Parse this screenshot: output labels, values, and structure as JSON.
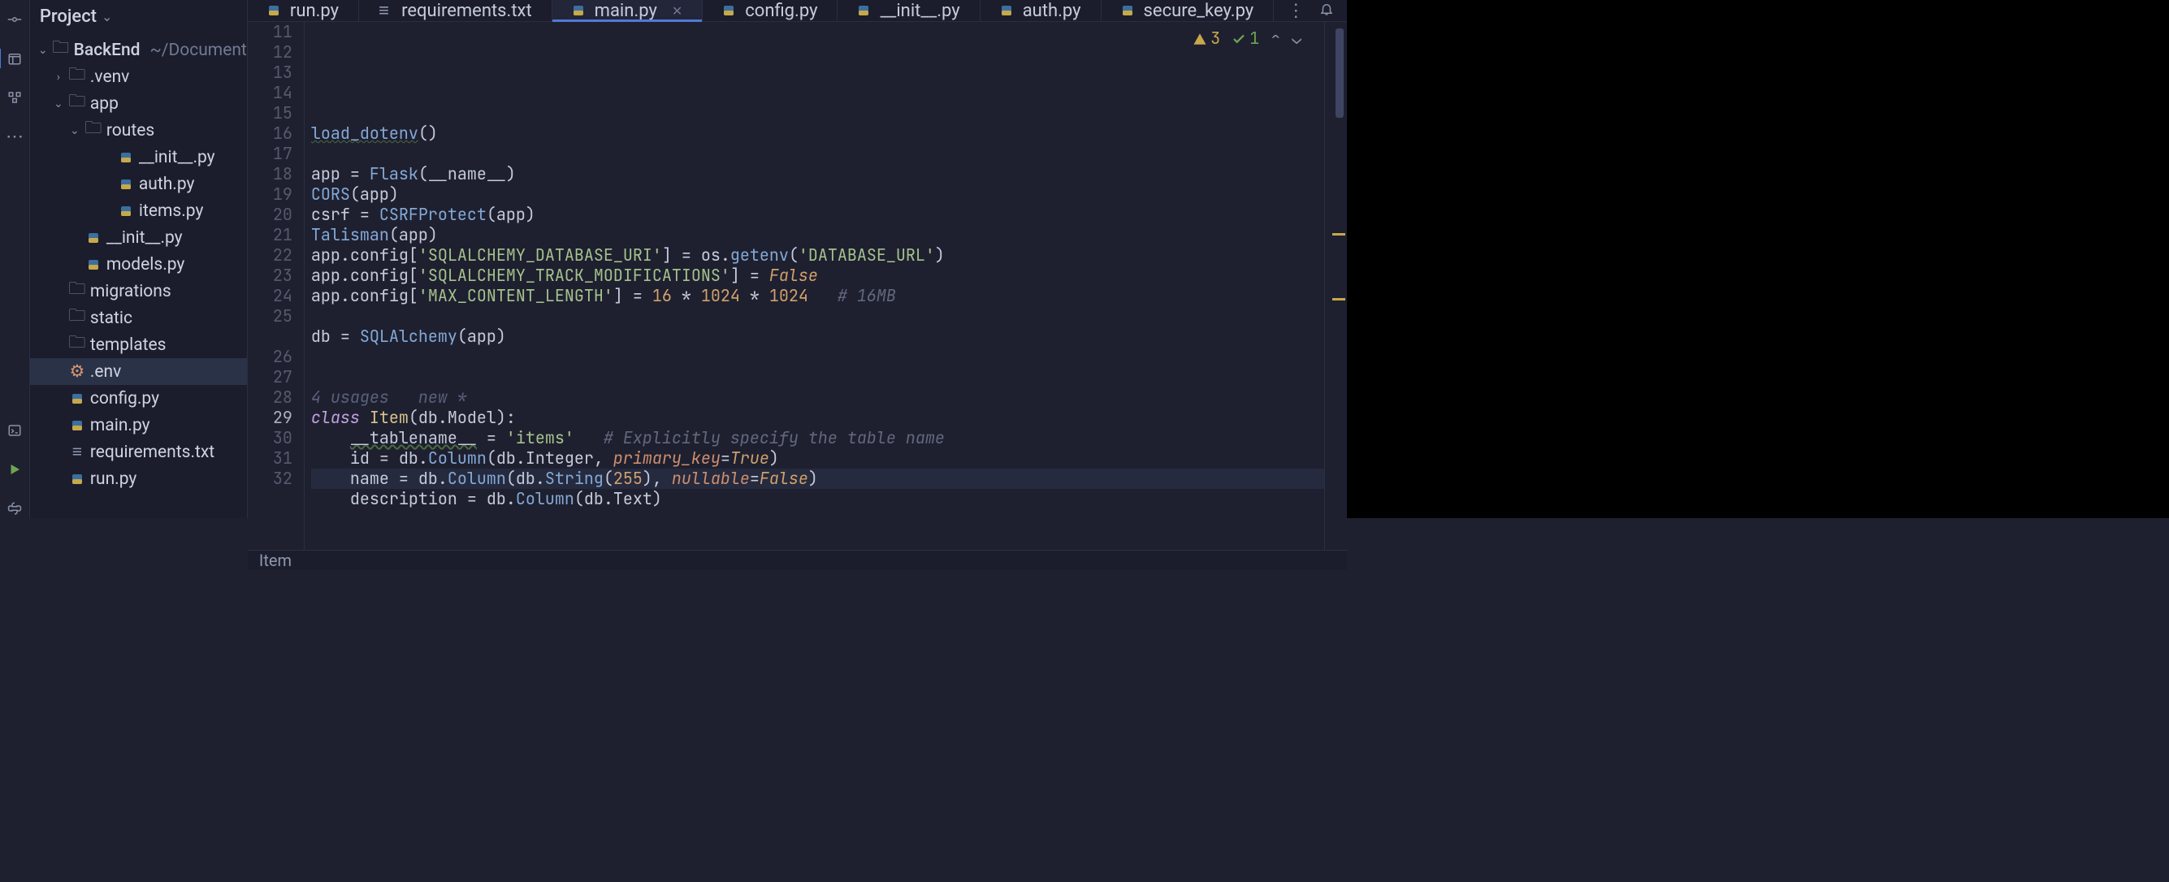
{
  "projectHeader": {
    "label": "Project"
  },
  "tree": {
    "root": {
      "name": "BackEnd",
      "path": "~/Documents/Dev"
    },
    "items": [
      {
        "name": ".venv",
        "depth": 1,
        "type": "folder",
        "expander": "›"
      },
      {
        "name": "app",
        "depth": 1,
        "type": "package",
        "expander": "⌄"
      },
      {
        "name": "routes",
        "depth": 2,
        "type": "package",
        "expander": "⌄"
      },
      {
        "name": "__init__.py",
        "depth": 3,
        "type": "py"
      },
      {
        "name": "auth.py",
        "depth": 3,
        "type": "py"
      },
      {
        "name": "items.py",
        "depth": 3,
        "type": "py"
      },
      {
        "name": "__init__.py",
        "depth": 2,
        "type": "py"
      },
      {
        "name": "models.py",
        "depth": 2,
        "type": "py"
      },
      {
        "name": "migrations",
        "depth": 1,
        "type": "folder"
      },
      {
        "name": "static",
        "depth": 1,
        "type": "folder"
      },
      {
        "name": "templates",
        "depth": 1,
        "type": "folder"
      },
      {
        "name": ".env",
        "depth": 1,
        "type": "env",
        "selected": true
      },
      {
        "name": "config.py",
        "depth": 1,
        "type": "py"
      },
      {
        "name": "main.py",
        "depth": 1,
        "type": "py"
      },
      {
        "name": "requirements.txt",
        "depth": 1,
        "type": "txt"
      },
      {
        "name": "run.py",
        "depth": 1,
        "type": "py"
      }
    ]
  },
  "tabs": [
    {
      "label": "run.py",
      "icon": "py"
    },
    {
      "label": "requirements.txt",
      "icon": "txt"
    },
    {
      "label": "main.py",
      "icon": "py",
      "active": true,
      "closable": true
    },
    {
      "label": "config.py",
      "icon": "py"
    },
    {
      "label": "__init__.py",
      "icon": "py"
    },
    {
      "label": "auth.py",
      "icon": "py"
    },
    {
      "label": "secure_key.py",
      "icon": "py"
    }
  ],
  "inspections": {
    "warnings": "3",
    "weakWarnings": "1"
  },
  "hintLine": "4 usages   new *",
  "code": {
    "firstLine": 11,
    "currentLine": 29,
    "lines": {
      "11": [],
      "12": [],
      "13": [
        {
          "t": "underline",
          "v": "load_dotenv"
        },
        {
          "t": "id",
          "v": "()"
        }
      ],
      "14": [],
      "15": [
        {
          "t": "id",
          "v": "app "
        },
        {
          "t": "id",
          "v": "= "
        },
        {
          "t": "call",
          "v": "Flask"
        },
        {
          "t": "id",
          "v": "(__name__)"
        }
      ],
      "16": [
        {
          "t": "call",
          "v": "CORS"
        },
        {
          "t": "id",
          "v": "(app)"
        }
      ],
      "17": [
        {
          "t": "id",
          "v": "csrf = "
        },
        {
          "t": "call",
          "v": "CSRFProtect"
        },
        {
          "t": "id",
          "v": "(app)"
        }
      ],
      "18": [
        {
          "t": "call",
          "v": "Talisman"
        },
        {
          "t": "id",
          "v": "(app)"
        }
      ],
      "19": [
        {
          "t": "id",
          "v": "app.config["
        },
        {
          "t": "str",
          "v": "'SQLALCHEMY_DATABASE_URI'"
        },
        {
          "t": "id",
          "v": "] = os."
        },
        {
          "t": "call",
          "v": "getenv"
        },
        {
          "t": "id",
          "v": "("
        },
        {
          "t": "str",
          "v": "'DATABASE_URL'"
        },
        {
          "t": "id",
          "v": ")"
        }
      ],
      "20": [
        {
          "t": "id",
          "v": "app.config["
        },
        {
          "t": "str",
          "v": "'SQLALCHEMY_TRACK_MODIFICATIONS'"
        },
        {
          "t": "id",
          "v": "] = "
        },
        {
          "t": "const",
          "v": "False"
        }
      ],
      "21": [
        {
          "t": "id",
          "v": "app.config["
        },
        {
          "t": "str",
          "v": "'MAX_CONTENT_LENGTH'"
        },
        {
          "t": "id",
          "v": "] = "
        },
        {
          "t": "num",
          "v": "16"
        },
        {
          "t": "id",
          "v": " * "
        },
        {
          "t": "num",
          "v": "1024"
        },
        {
          "t": "id",
          "v": " * "
        },
        {
          "t": "num",
          "v": "1024"
        },
        {
          "t": "id",
          "v": "   "
        },
        {
          "t": "cmt",
          "v": "# 16MB"
        }
      ],
      "22": [],
      "23": [
        {
          "t": "id",
          "v": "db = "
        },
        {
          "t": "call",
          "v": "SQLAlchemy"
        },
        {
          "t": "id",
          "v": "(app)"
        }
      ],
      "24": [],
      "25": [],
      "26": [
        {
          "t": "kw",
          "v": "class "
        },
        {
          "t": "class",
          "v": "Item"
        },
        {
          "t": "id",
          "v": "(db.Model):"
        }
      ],
      "27": [
        {
          "t": "id",
          "v": "    "
        },
        {
          "t": "underline2",
          "v": "__tablename__"
        },
        {
          "t": "id",
          "v": " = "
        },
        {
          "t": "str",
          "v": "'items'"
        },
        {
          "t": "id",
          "v": "   "
        },
        {
          "t": "cmt",
          "v": "# Explicitly specify the table name"
        }
      ],
      "28": [
        {
          "t": "id",
          "v": "    id = db."
        },
        {
          "t": "call",
          "v": "Column"
        },
        {
          "t": "id",
          "v": "(db.Integer, "
        },
        {
          "t": "param",
          "v": "primary_key"
        },
        {
          "t": "id",
          "v": "="
        },
        {
          "t": "const",
          "v": "True"
        },
        {
          "t": "id",
          "v": ")"
        }
      ],
      "29": [
        {
          "t": "id",
          "v": "    name = db."
        },
        {
          "t": "call",
          "v": "Column"
        },
        {
          "t": "id",
          "v": "(db."
        },
        {
          "t": "call",
          "v": "String"
        },
        {
          "t": "id",
          "v": "("
        },
        {
          "t": "num",
          "v": "255"
        },
        {
          "t": "id",
          "v": "), "
        },
        {
          "t": "param",
          "v": "nullable"
        },
        {
          "t": "id",
          "v": "="
        },
        {
          "t": "const",
          "v": "False"
        },
        {
          "t": "id",
          "v": ")"
        }
      ],
      "30": [
        {
          "t": "id",
          "v": "    description = db."
        },
        {
          "t": "call",
          "v": "Column"
        },
        {
          "t": "id",
          "v": "(db.Text)"
        }
      ],
      "31": [],
      "32": []
    }
  },
  "breadcrumb": "Item",
  "colors": {
    "accent": "#4f7ad6"
  }
}
